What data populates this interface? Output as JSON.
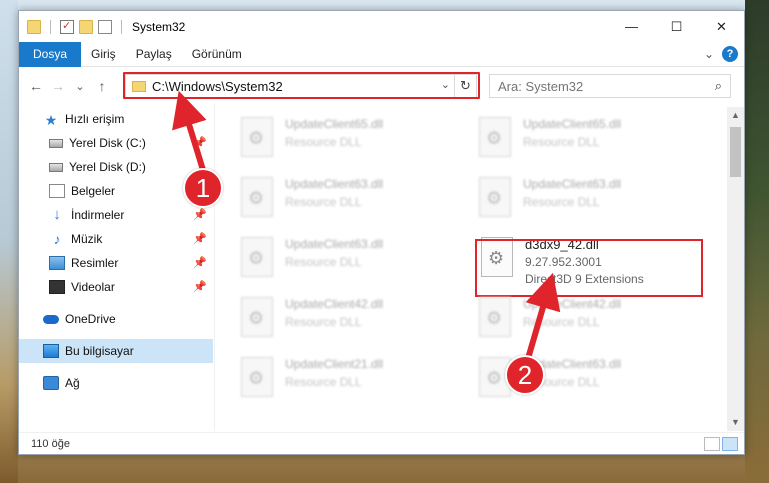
{
  "window": {
    "title": "System32",
    "controls": {
      "minimize": "—",
      "maximize": "☐",
      "close": "✕"
    }
  },
  "ribbon": {
    "tabs": [
      "Dosya",
      "Giriş",
      "Paylaş",
      "Görünüm"
    ],
    "expand_label": "⌄",
    "help_label": "?"
  },
  "nav": {
    "back": "←",
    "forward": "→",
    "recent": "⌄",
    "up": "↑",
    "address": "C:\\Windows\\System32",
    "address_dropdown": "⌄",
    "refresh": "↻",
    "search_placeholder": "Ara: System32",
    "search_icon": "⌕"
  },
  "sidebar": {
    "items": [
      {
        "label": "Hızlı erişim",
        "icon": "star-icon",
        "pinned": false,
        "selected": false
      },
      {
        "label": "Yerel Disk (C:)",
        "icon": "disk-icon",
        "pinned": true,
        "selected": false
      },
      {
        "label": "Yerel Disk (D:)",
        "icon": "disk-icon",
        "pinned": true,
        "selected": false
      },
      {
        "label": "Belgeler",
        "icon": "documents-icon",
        "pinned": true,
        "selected": false
      },
      {
        "label": "İndirmeler",
        "icon": "downloads-icon",
        "pinned": true,
        "selected": false
      },
      {
        "label": "Müzik",
        "icon": "music-icon",
        "pinned": true,
        "selected": false
      },
      {
        "label": "Resimler",
        "icon": "pictures-icon",
        "pinned": true,
        "selected": false
      },
      {
        "label": "Videolar",
        "icon": "videos-icon",
        "pinned": true,
        "selected": false
      },
      {
        "label": "OneDrive",
        "icon": "onedrive-icon",
        "pinned": false,
        "selected": false
      },
      {
        "label": "Bu bilgisayar",
        "icon": "this-pc-icon",
        "pinned": false,
        "selected": true
      },
      {
        "label": "Ağ",
        "icon": "network-icon",
        "pinned": false,
        "selected": false
      }
    ],
    "pin_glyph": "📌"
  },
  "files": [
    {
      "name": "UpdateClient65.dll",
      "type": "Resource DLL"
    },
    {
      "name": "UpdateClient65.dll",
      "type": "Resource DLL"
    },
    {
      "name": "UpdateClient63.dll",
      "type": "Resource DLL"
    },
    {
      "name": "UpdateClient63.dll",
      "type": "Resource DLL"
    },
    {
      "name": "UpdateClient63.dll",
      "type": "Resource DLL"
    },
    {
      "name": "d3dx9_42.dll",
      "version": "9.27.952.3001",
      "type": "Direct3D 9 Extensions",
      "highlighted": true
    },
    {
      "name": "UpdateClient42.dll",
      "type": "Resource DLL"
    },
    {
      "name": "UpdateClient42.dll",
      "type": "Resource DLL"
    },
    {
      "name": "UpdateClient21.dll",
      "type": "Resource DLL"
    },
    {
      "name": "UpdateClient63.dll",
      "type": "Resource DLL"
    }
  ],
  "status": {
    "item_count": "110 öğe"
  },
  "callouts": {
    "step1": "1",
    "step2": "2"
  },
  "colors": {
    "accent": "#1979ca",
    "callout_red": "#e0242b",
    "selected_bg": "#cce4f7"
  }
}
